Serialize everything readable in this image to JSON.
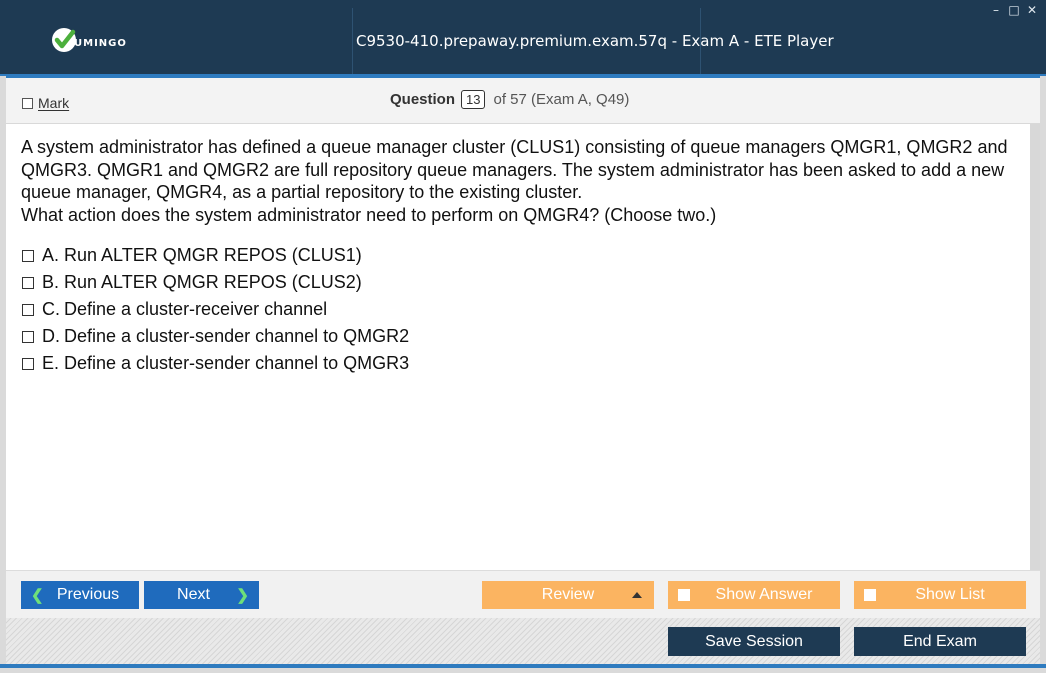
{
  "window": {
    "title": "C9530-410.prepaway.premium.exam.57q - Exam A - ETE Player",
    "logo_text": "UMINGO",
    "controls": [
      "minimize-icon",
      "maximize-icon",
      "close-icon"
    ],
    "accent_color": "#1e3a53",
    "highlight_color": "#2e7bbf"
  },
  "header": {
    "mark_label": "Mark",
    "question_label": "Question",
    "question_number": "13",
    "question_of": "of 57 (Exam A, Q49)"
  },
  "question": {
    "lines": [
      "A system administrator has defined a queue manager cluster (CLUS1) consisting of queue managers QMGR1, QMGR2 and QMGR3. QMGR1 and QMGR2 are full repository queue managers. The system administrator has been asked to add a new queue manager, QMGR4, as a partial repository to the existing cluster.",
      "What action does the system administrator need to perform on QMGR4? (Choose two.)"
    ],
    "options": [
      {
        "letter": "A.",
        "text": "Run ALTER QMGR REPOS (CLUS1)"
      },
      {
        "letter": "B.",
        "text": "Run ALTER QMGR REPOS (CLUS2)"
      },
      {
        "letter": "C.",
        "text": "Define a cluster-receiver channel"
      },
      {
        "letter": "D.",
        "text": "Define a cluster-sender channel to QMGR2"
      },
      {
        "letter": "E.",
        "text": "Define a cluster-sender channel to QMGR3"
      }
    ]
  },
  "zoom": [
    "search-icon",
    "zoom-in-icon",
    "zoom-out-icon"
  ],
  "nav": {
    "previous": "Previous",
    "next": "Next",
    "review": "Review",
    "show_answer": "Show Answer",
    "show_list": "Show List"
  },
  "footer": {
    "save_session": "Save Session",
    "end_exam": "End Exam"
  }
}
